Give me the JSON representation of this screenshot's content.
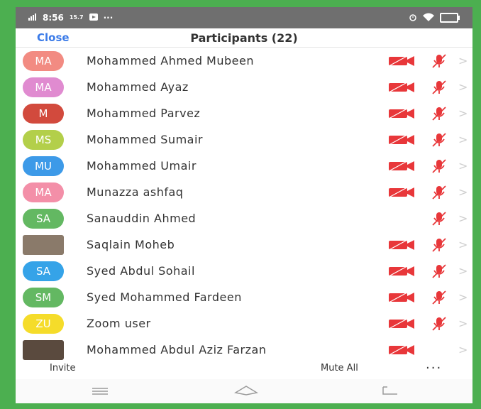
{
  "status_bar": {
    "time": "8:56",
    "net_speed": "15.7",
    "icons": [
      "signal-icon",
      "notification-icon",
      "more-dots-icon",
      "alarm-icon",
      "wifi-icon",
      "battery-icon"
    ]
  },
  "header": {
    "close_label": "Close",
    "title": "Participants (22)"
  },
  "colors": {
    "accent_blue": "#3b7be8",
    "muted_red": "#e8373a",
    "frame_green": "#4caf50"
  },
  "participants": [
    {
      "initials": "MA",
      "name": "Mohammed Ahmed Mubeen",
      "avatar_color": "#f28b82",
      "video_off": true,
      "mic_muted": true
    },
    {
      "initials": "MA",
      "name": "Mohammed Ayaz",
      "avatar_color": "#e08bd0",
      "video_off": true,
      "mic_muted": true
    },
    {
      "initials": "M",
      "name": "Mohammed Parvez",
      "avatar_color": "#d24a3d",
      "video_off": true,
      "mic_muted": true
    },
    {
      "initials": "MS",
      "name": "Mohammed Sumair",
      "avatar_color": "#b3cf4a",
      "video_off": true,
      "mic_muted": true
    },
    {
      "initials": "MU",
      "name": "Mohammed Umair",
      "avatar_color": "#3d9ae8",
      "video_off": true,
      "mic_muted": true
    },
    {
      "initials": "MA",
      "name": "Munazza ashfaq",
      "avatar_color": "#f38fa8",
      "video_off": true,
      "mic_muted": true
    },
    {
      "initials": "SA",
      "name": "Sanauddin Ahmed",
      "avatar_color": "#63b862",
      "video_off": false,
      "mic_muted": true
    },
    {
      "initials": "",
      "name": "Saqlain Moheb",
      "avatar_color": "#8a7a6a",
      "photo": true,
      "video_off": true,
      "mic_muted": true
    },
    {
      "initials": "SA",
      "name": "Syed Abdul Sohail",
      "avatar_color": "#35a3e8",
      "video_off": true,
      "mic_muted": true
    },
    {
      "initials": "SM",
      "name": "Syed Mohammed Fardeen",
      "avatar_color": "#63b862",
      "video_off": true,
      "mic_muted": true
    },
    {
      "initials": "ZU",
      "name": "Zoom user",
      "avatar_color": "#f5dc2a",
      "video_off": true,
      "mic_muted": true
    },
    {
      "initials": "",
      "name": "Mohammed Abdul Aziz Farzan",
      "avatar_color": "#5a4a3e",
      "photo": true,
      "video_off": true,
      "mic_muted": false
    }
  ],
  "actions": {
    "invite_label": "Invite",
    "mute_all_label": "Mute All",
    "more_label": "···"
  }
}
